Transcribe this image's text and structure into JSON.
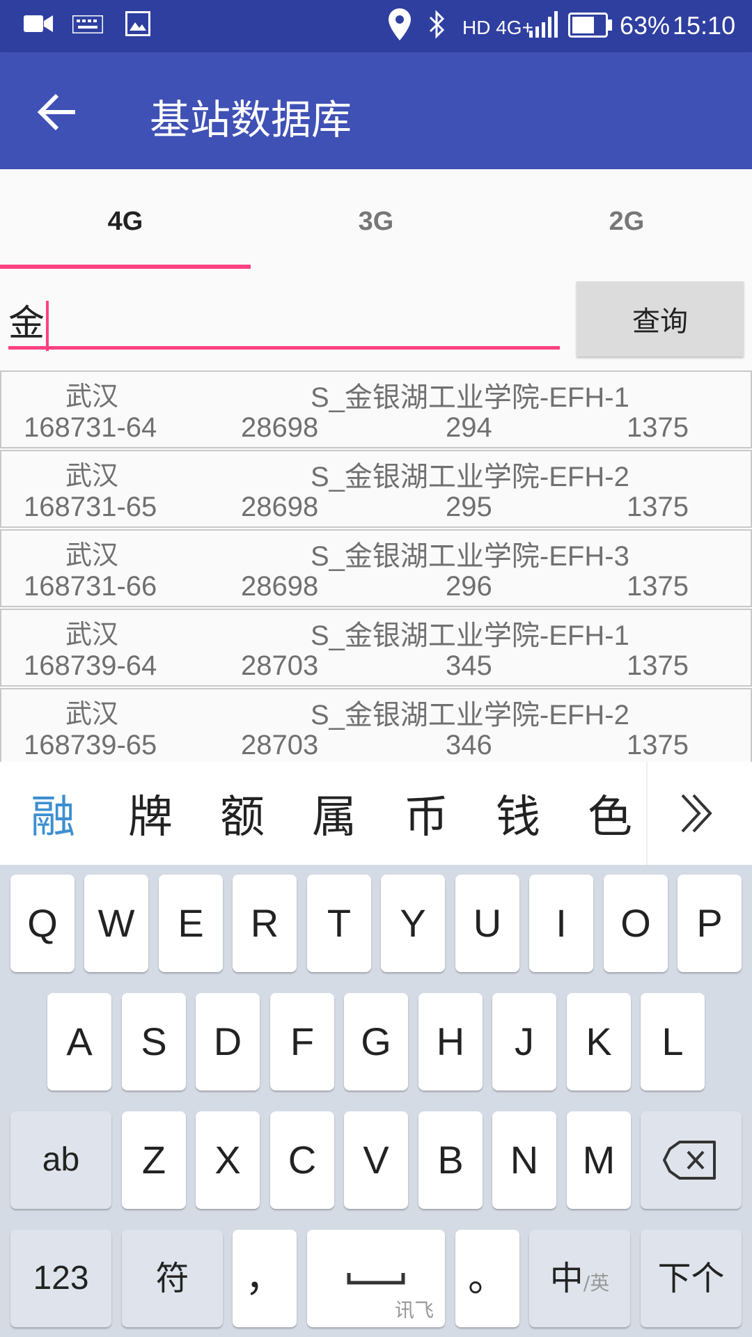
{
  "status_bar": {
    "network": "HD 4G+",
    "battery": "63%",
    "time": "15:10"
  },
  "app_bar": {
    "title": "基站数据库"
  },
  "tabs": [
    {
      "label": "4G",
      "active": true
    },
    {
      "label": "3G",
      "active": false
    },
    {
      "label": "2G",
      "active": false
    }
  ],
  "search": {
    "value": "金",
    "button_label": "查询"
  },
  "results": [
    {
      "city": "武汉",
      "name": "S_金银湖工业学院-EFH-1",
      "id": "168731-64",
      "tac": "28698",
      "pci": "294",
      "earfcn": "1375"
    },
    {
      "city": "武汉",
      "name": "S_金银湖工业学院-EFH-2",
      "id": "168731-65",
      "tac": "28698",
      "pci": "295",
      "earfcn": "1375"
    },
    {
      "city": "武汉",
      "name": "S_金银湖工业学院-EFH-3",
      "id": "168731-66",
      "tac": "28698",
      "pci": "296",
      "earfcn": "1375"
    },
    {
      "city": "武汉",
      "name": "S_金银湖工业学院-EFH-1",
      "id": "168739-64",
      "tac": "28703",
      "pci": "345",
      "earfcn": "1375"
    },
    {
      "city": "武汉",
      "name": "S_金银湖工业学院-EFH-2",
      "id": "168739-65",
      "tac": "28703",
      "pci": "346",
      "earfcn": "1375"
    }
  ],
  "candidates": [
    "融",
    "牌",
    "额",
    "属",
    "币",
    "钱",
    "色"
  ],
  "keyboard": {
    "row1": [
      "Q",
      "W",
      "E",
      "R",
      "T",
      "Y",
      "U",
      "I",
      "O",
      "P"
    ],
    "row2": [
      "A",
      "S",
      "D",
      "F",
      "G",
      "H",
      "J",
      "K",
      "L"
    ],
    "row3": [
      "Z",
      "X",
      "C",
      "V",
      "B",
      "N",
      "M"
    ],
    "mode_key": "ab",
    "numbers_key": "123",
    "symbols_key": "符",
    "comma_key": "，",
    "space_brand": "讯飞",
    "period_key": "。",
    "lang_main": "中",
    "lang_sub": "/英",
    "next_key": "下个"
  },
  "colors": {
    "status_bar": "#2f3fa0",
    "app_bar": "#3f51b5",
    "accent": "#ff4081",
    "candidate_highlight": "#3d8fd0"
  }
}
